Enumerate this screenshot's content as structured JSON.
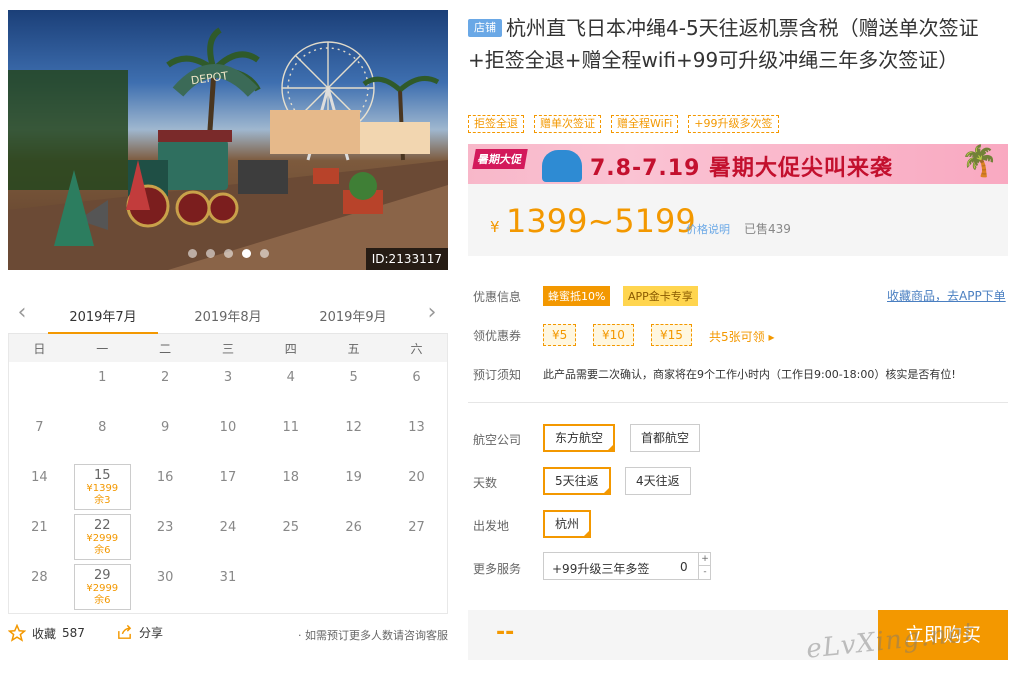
{
  "photo": {
    "id_label": "ID:2133117",
    "slides": 5,
    "active_slide": 4,
    "sign_text": "DEPOT"
  },
  "calendar": {
    "prev_label": "‹",
    "next_label": "›",
    "months": [
      "2019年7月",
      "2019年8月",
      "2019年9月"
    ],
    "active_month": 0,
    "weekdays": [
      "日",
      "一",
      "二",
      "三",
      "四",
      "五",
      "六"
    ],
    "weeks": [
      [
        {
          "d": ""
        },
        {
          "d": "1"
        },
        {
          "d": "2"
        },
        {
          "d": "3"
        },
        {
          "d": "4"
        },
        {
          "d": "5"
        },
        {
          "d": "6"
        }
      ],
      [
        {
          "d": "7"
        },
        {
          "d": "8"
        },
        {
          "d": "9"
        },
        {
          "d": "10"
        },
        {
          "d": "11"
        },
        {
          "d": "12"
        },
        {
          "d": "13"
        }
      ],
      [
        {
          "d": "14"
        },
        {
          "d": "15",
          "price": "¥1399",
          "left": "余3"
        },
        {
          "d": "16"
        },
        {
          "d": "17"
        },
        {
          "d": "18"
        },
        {
          "d": "19"
        },
        {
          "d": "20"
        }
      ],
      [
        {
          "d": "21"
        },
        {
          "d": "22",
          "price": "¥2999",
          "left": "余6"
        },
        {
          "d": "23"
        },
        {
          "d": "24"
        },
        {
          "d": "25"
        },
        {
          "d": "26"
        },
        {
          "d": "27"
        }
      ],
      [
        {
          "d": "28"
        },
        {
          "d": "29",
          "price": "¥2999",
          "left": "余6"
        },
        {
          "d": "30"
        },
        {
          "d": "31"
        },
        {
          "d": ""
        },
        {
          "d": ""
        },
        {
          "d": ""
        }
      ]
    ]
  },
  "actions": {
    "favorite_label": "收藏",
    "favorite_count": "587",
    "share_label": "分享",
    "consult_text": "· 如需预订更多人数请咨询客服"
  },
  "product": {
    "store_tag": "店铺",
    "title": "杭州直飞日本冲绳4-5天往返机票含税（赠送单次签证+拒签全退+赠全程wifi+99可升级冲绳三年多次签证）",
    "tags": [
      "拒签全退",
      "赠单次签证",
      "赠全程WiFi",
      "+99升级多次签"
    ]
  },
  "banner": {
    "badge": "暑期大促",
    "text": "7.8-7.19 暑期大促尖叫来袭"
  },
  "price": {
    "currency": "¥",
    "range": "1399~5199",
    "note": "价格说明",
    "sold": "已售439"
  },
  "promo": {
    "label": "优惠信息",
    "badge1": "蜂蜜抵10%",
    "badge2": "APP金卡专享",
    "fav_link": "收藏商品，去APP下单"
  },
  "coupons": {
    "label": "领优惠券",
    "items": [
      "¥5",
      "¥10",
      "¥15"
    ],
    "more": "共5张可领 ▸"
  },
  "notice": {
    "label": "预订须知",
    "text": "此产品需要二次确认，商家将在9个工作小时内（工作日9:00-18:00）核实是否有位!"
  },
  "options": {
    "airline": {
      "label": "航空公司",
      "choices": [
        "东方航空",
        "首都航空"
      ],
      "selected": 0
    },
    "days": {
      "label": "天数",
      "choices": [
        "5天往返",
        "4天往返"
      ],
      "selected": 0
    },
    "depart": {
      "label": "出发地",
      "choices": [
        "杭州"
      ],
      "selected": 0
    },
    "services": {
      "label": "更多服务",
      "item": "+99升级三年多签",
      "qty": "0",
      "plus": "+",
      "minus": "-"
    }
  },
  "buy": {
    "total": "--",
    "button": "立即购买"
  },
  "watermark": "eLvXing.net"
}
